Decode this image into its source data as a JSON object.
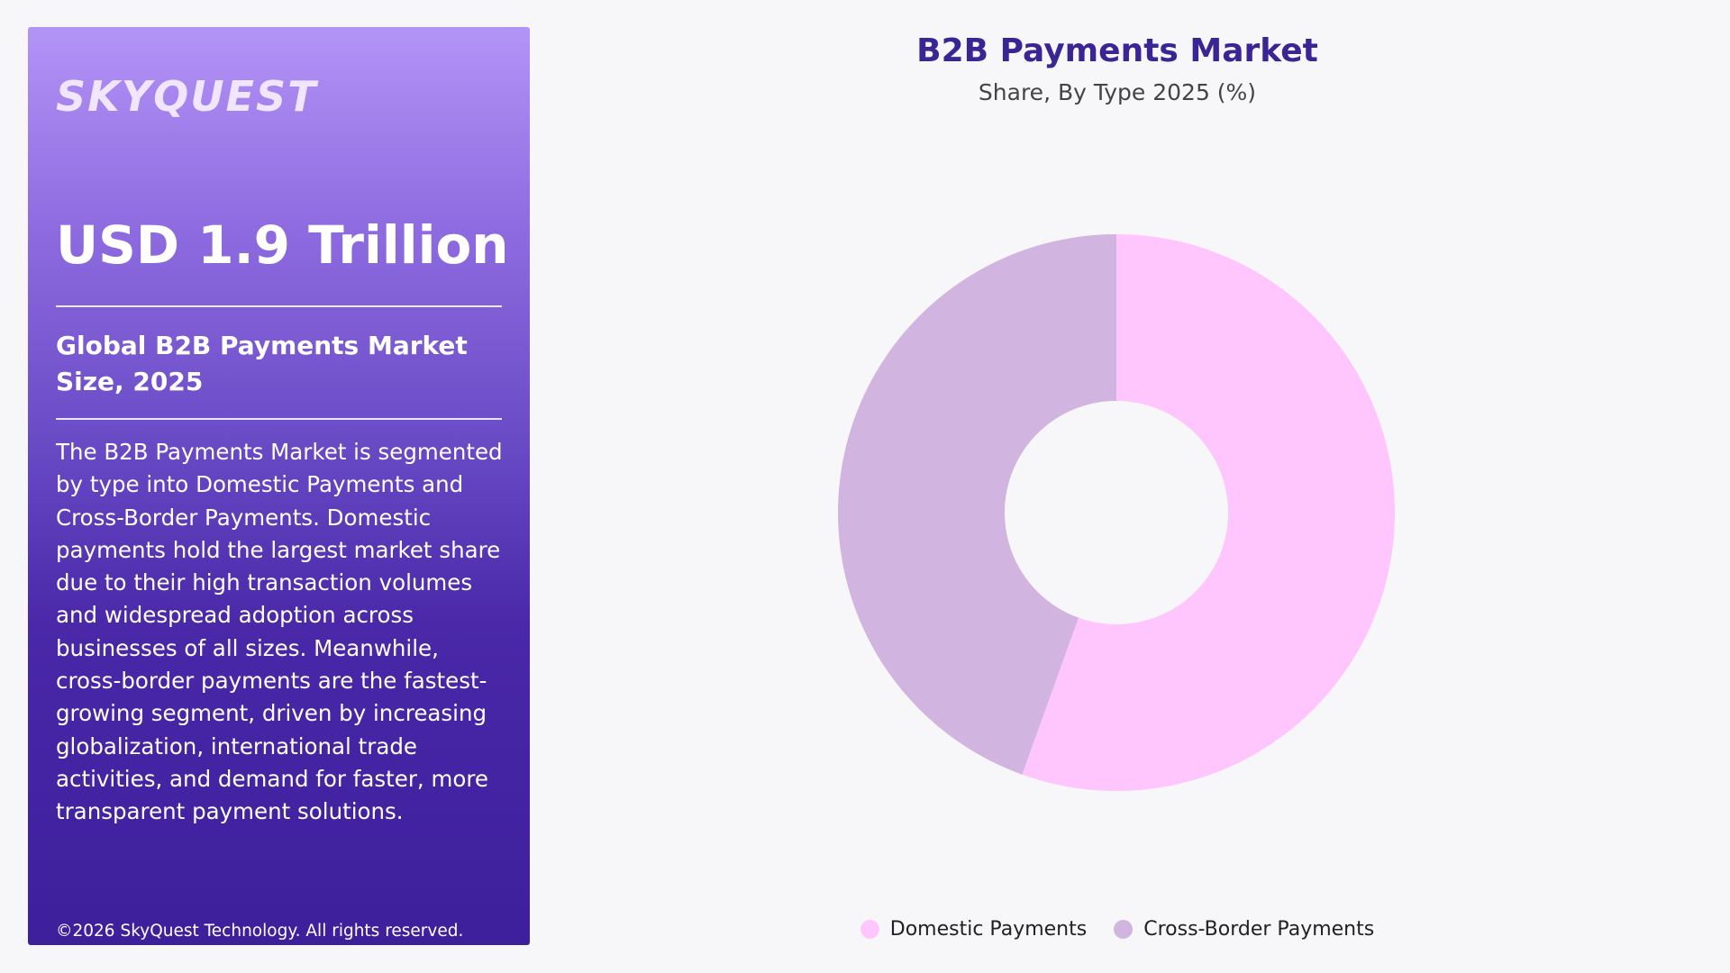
{
  "panel": {
    "logo": "SKYQUEST",
    "headline": "USD 1.9 Trillion",
    "subhead": "Global B2B Payments Market Size, 2025",
    "description": "The B2B Payments Market is segmented by type into Domestic Payments and Cross-Border Payments. Domestic payments hold the largest market share due to their high transaction volumes and widespread adoption across businesses of all sizes. Meanwhile, cross-border payments are the fastest-growing segment, driven by increasing globalization, international trade activities, and demand for faster, more transparent payment solutions.",
    "copyright": "©2026 SkyQuest Technology. All rights reserved."
  },
  "chart_data": {
    "type": "pie",
    "variant": "donut",
    "title": "B2B Payments Market",
    "subtitle": "Share, By Type 2025 (%)",
    "categories": [
      "Domestic Payments",
      "Cross-Border Payments"
    ],
    "values": [
      55.5,
      44.5
    ],
    "colors": [
      "#fec6fd",
      "#d1b4e0"
    ],
    "legend": "bottom-center"
  },
  "colors": {
    "title": "#3a2595",
    "panel_top": "#b394f6",
    "panel_bottom": "#3d1f9b",
    "background": "#f7f7f9"
  }
}
